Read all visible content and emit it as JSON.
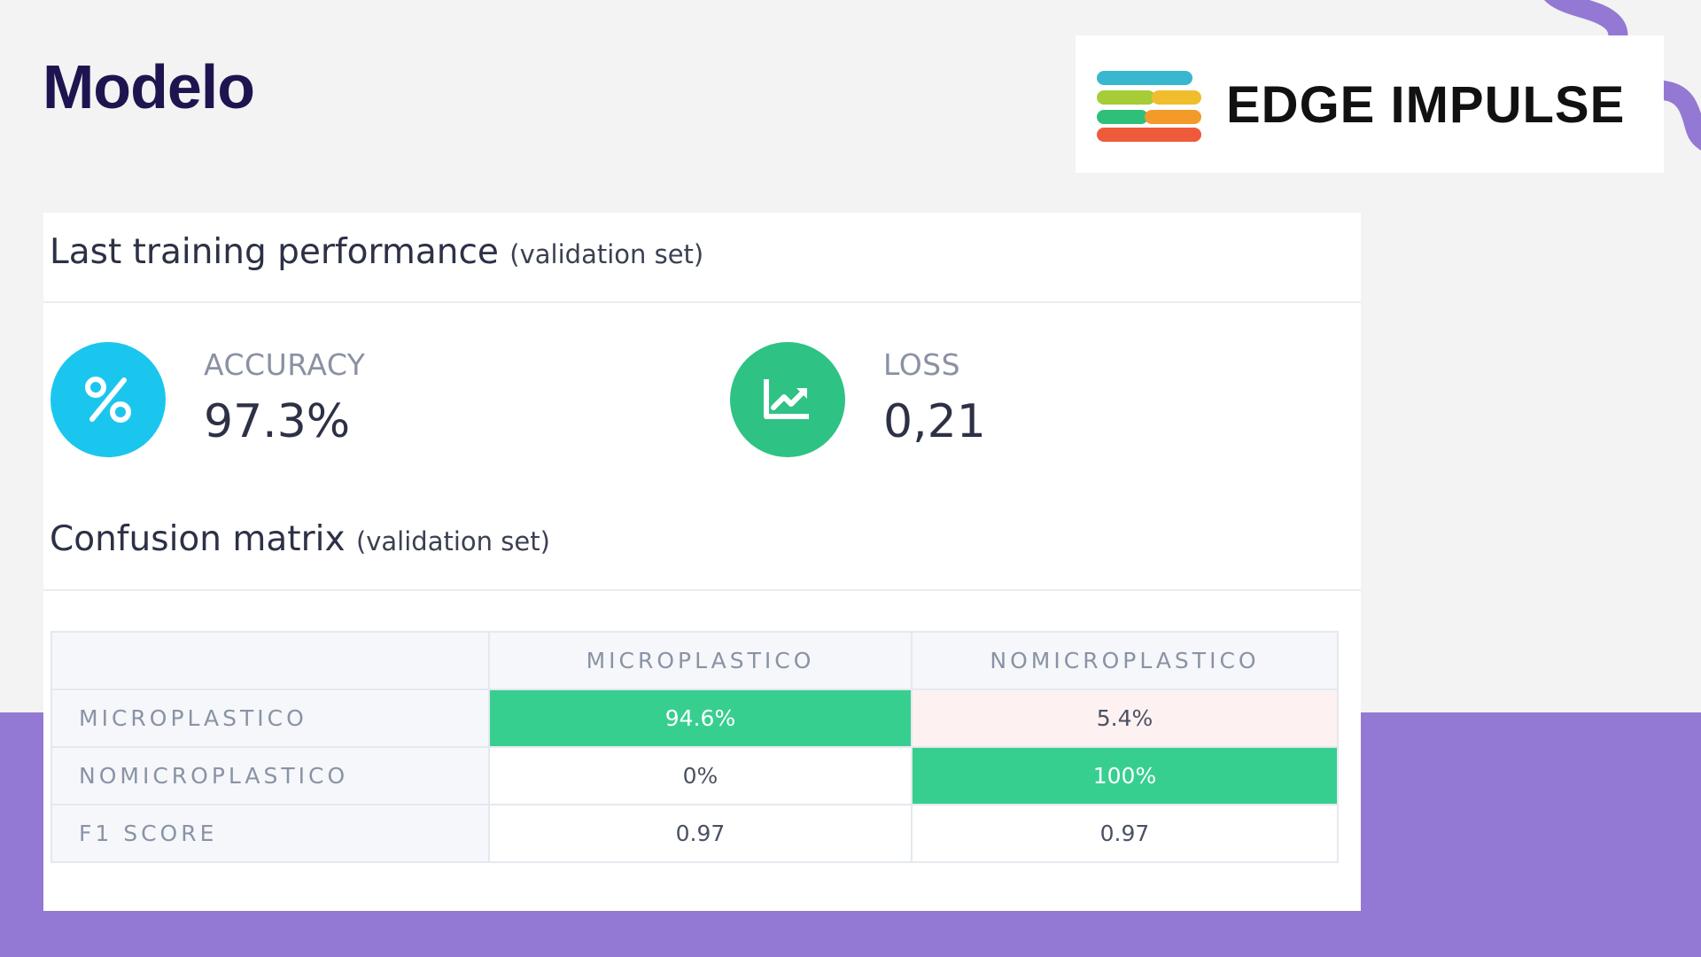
{
  "slide": {
    "title": "Modelo",
    "logo_text": "EDGE IMPULSE"
  },
  "performance": {
    "title": "Last training performance",
    "subtitle": "(validation set)",
    "accuracy": {
      "label": "ACCURACY",
      "value": "97.3%",
      "icon": "percent-icon",
      "color": "#1bc6ee"
    },
    "loss": {
      "label": "LOSS",
      "value": "0,21",
      "icon": "trend-chart-icon",
      "color": "#2fc285"
    }
  },
  "confusion": {
    "title": "Confusion matrix",
    "subtitle": "(validation set)",
    "columns": [
      "MICROPLASTICO",
      "NOMICROPLASTICO"
    ],
    "rows": [
      {
        "label": "MICROPLASTICO",
        "cells": [
          "94.6%",
          "5.4%"
        ]
      },
      {
        "label": "NOMICROPLASTICO",
        "cells": [
          "0%",
          "100%"
        ]
      },
      {
        "label": "F1 SCORE",
        "cells": [
          "0.97",
          "0.97"
        ]
      }
    ]
  },
  "colors": {
    "accent_purple": "#9379d3",
    "title_navy": "#1e1550",
    "correct_green": "#37cf8f",
    "error_pink": "#fdf1f1"
  }
}
